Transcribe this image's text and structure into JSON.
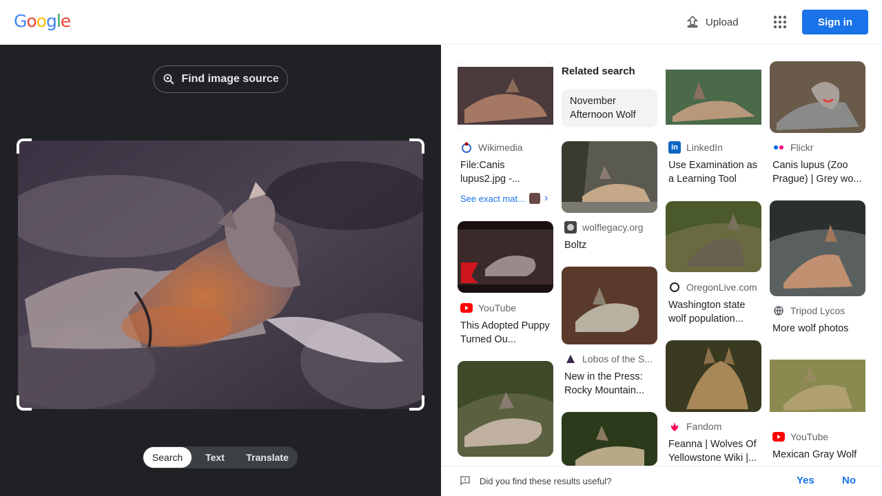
{
  "header": {
    "logo": {
      "g1": "G",
      "o1": "o",
      "o2": "o",
      "g2": "g",
      "l": "l",
      "e": "e"
    },
    "upload_label": "Upload",
    "signin_label": "Sign in"
  },
  "left": {
    "find_source_label": "Find image source",
    "modes": [
      "Search",
      "Text",
      "Translate"
    ],
    "active_mode": "Search"
  },
  "related": {
    "heading": "Related search",
    "chip": "November Afternoon Wolf"
  },
  "results": [
    {
      "source": "Wikimedia",
      "title": "File:Canis lupus2.jpg -...",
      "see_exact": "See exact mat..."
    },
    {
      "source": "YouTube",
      "title": "This Adopted Puppy Turned Ou..."
    },
    {
      "source": "wolflegacy.org",
      "title": "Boltz"
    },
    {
      "source": "Lobos of the S...",
      "title": "New in the Press: Rocky Mountain..."
    },
    {
      "source": "LinkedIn",
      "title": "Use Examination as a Learning Tool"
    },
    {
      "source": "OregonLive.com",
      "title": "Washington state wolf population..."
    },
    {
      "source": "Fandom",
      "title": "Feanna | Wolves Of Yellowstone Wiki |..."
    },
    {
      "source": "Flickr",
      "title": "Canis lupus (Zoo Prague) | Grey wo..."
    },
    {
      "source": "Tripod Lycos",
      "title": "More wolf photos"
    },
    {
      "source": "YouTube",
      "title": "Mexican Gray Wolf"
    }
  ],
  "feedback": {
    "question": "Did you find these results useful?",
    "yes": "Yes",
    "no": "No"
  },
  "colors": {
    "accent": "#1a73e8",
    "dark_panel": "#202124",
    "youtube": "#ff0000",
    "linkedin": "#0a66c2"
  }
}
